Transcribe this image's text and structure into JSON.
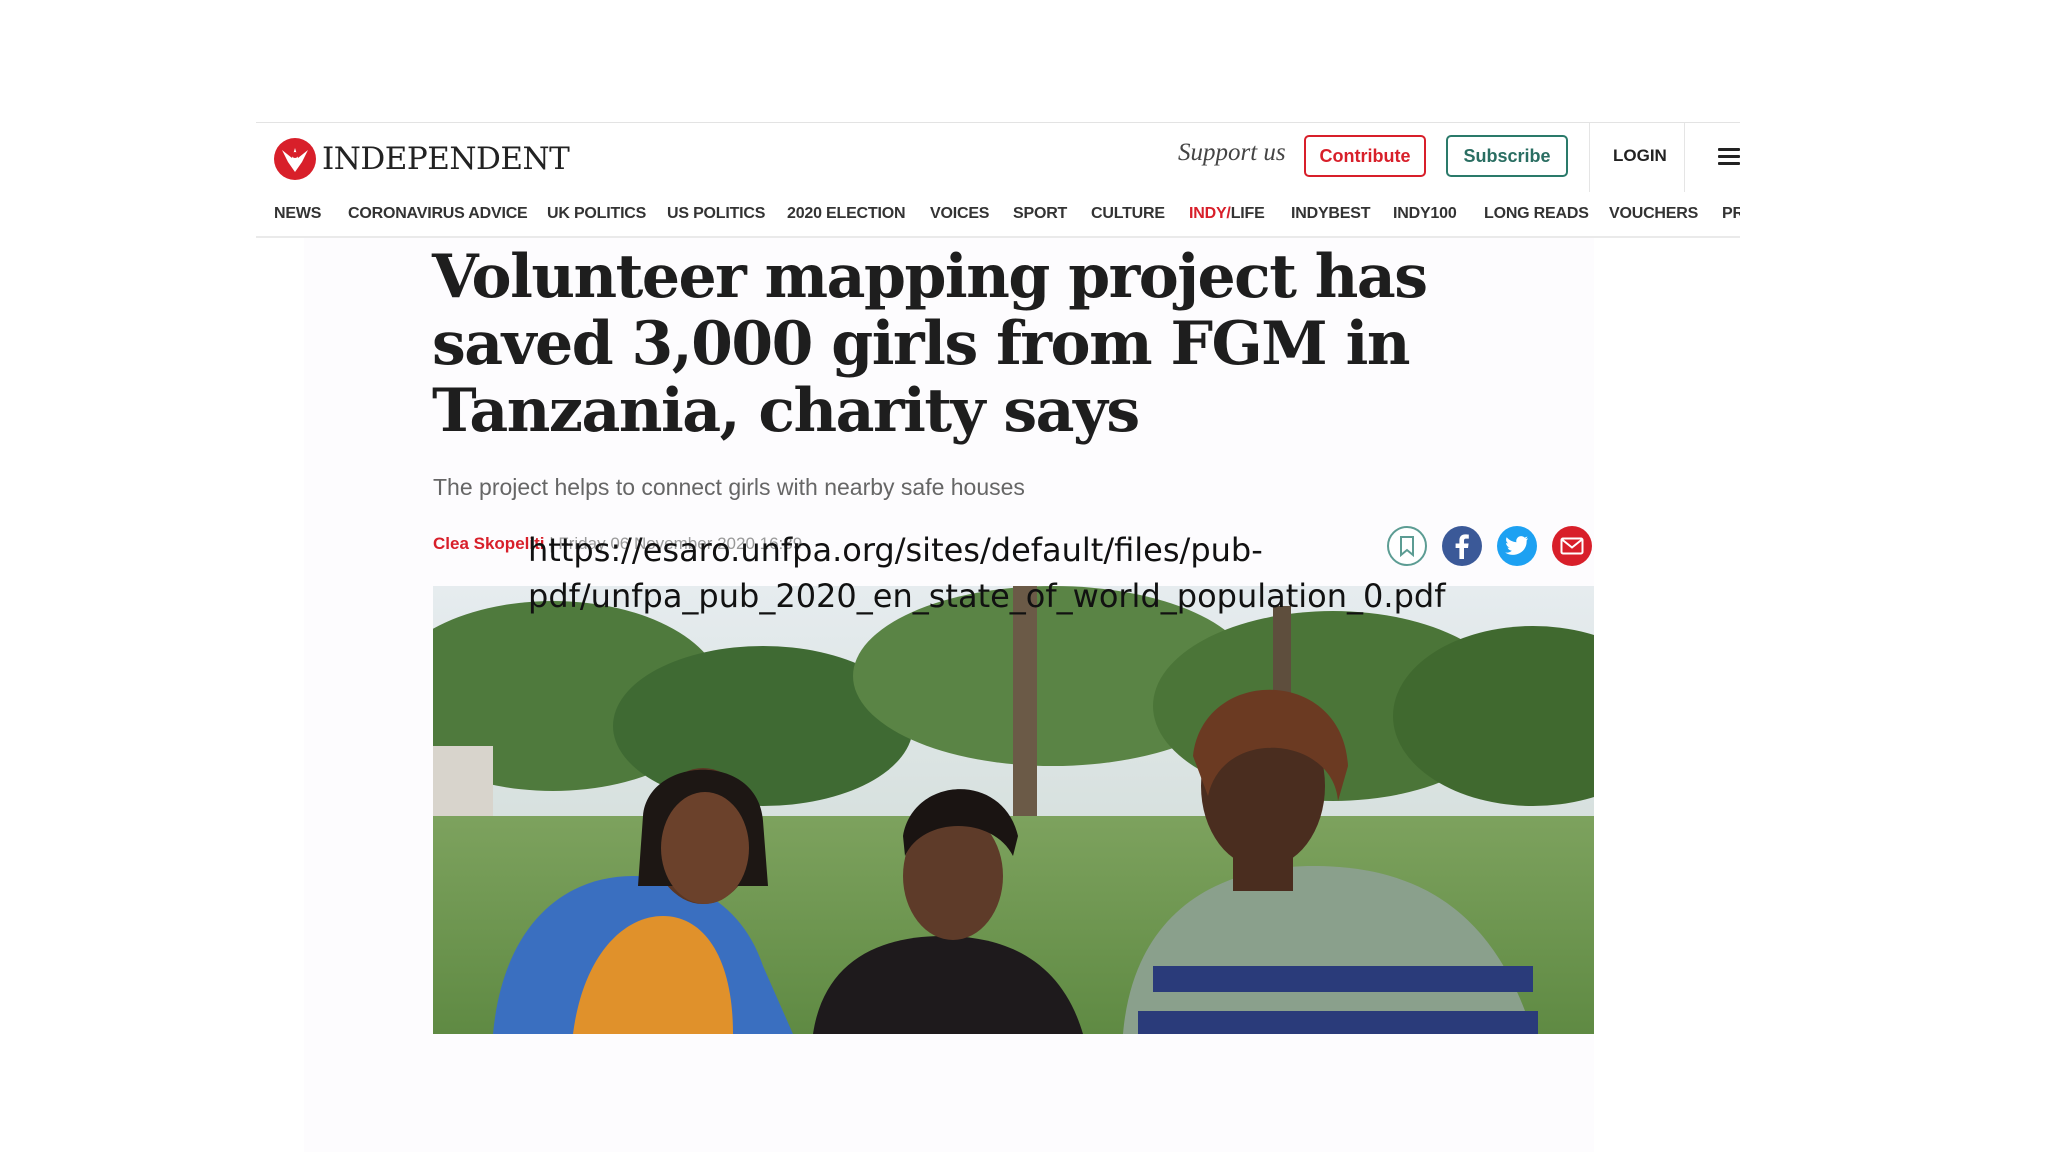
{
  "site": {
    "logo_text": "INDEPENDENT",
    "support_text": "Support us",
    "contribute_label": "Contribute",
    "subscribe_label": "Subscribe",
    "login_label": "LOGIN"
  },
  "nav": {
    "items": [
      "NEWS",
      "CORONAVIRUS ADVICE",
      "UK POLITICS",
      "US POLITICS",
      "2020 ELECTION",
      "VOICES",
      "SPORT",
      "CULTURE",
      "INDY/LIFE",
      "INDYBEST",
      "INDY100",
      "LONG READS",
      "VOUCHERS",
      "PR"
    ],
    "indy_prefix": "INDY/",
    "indy_suffix": "LIFE"
  },
  "article": {
    "headline": "Volunteer mapping project has saved 3,000 girls from FGM in Tanzania, charity says",
    "standfirst": "The project helps to connect girls with nearby safe houses",
    "author": "Clea Skopeliti",
    "separator": " | ",
    "date": "Friday 06 November 2020 16:39",
    "image_alt": "Three women looking together at a phone outdoors"
  },
  "share": {
    "icons": [
      "bookmark-icon",
      "facebook-icon",
      "twitter-icon",
      "email-icon"
    ]
  },
  "overlay": {
    "url_line1": "https://esaro.unfpa.org/sites/default/files/pub-",
    "url_line2": "pdf/unfpa_pub_2020_en_state_of_world_population_0.pdf"
  },
  "colors": {
    "brand_red": "#d81f2a",
    "subscribe_green": "#2a6e62",
    "facebook_blue": "#3b5998",
    "twitter_blue": "#1da1f2"
  }
}
